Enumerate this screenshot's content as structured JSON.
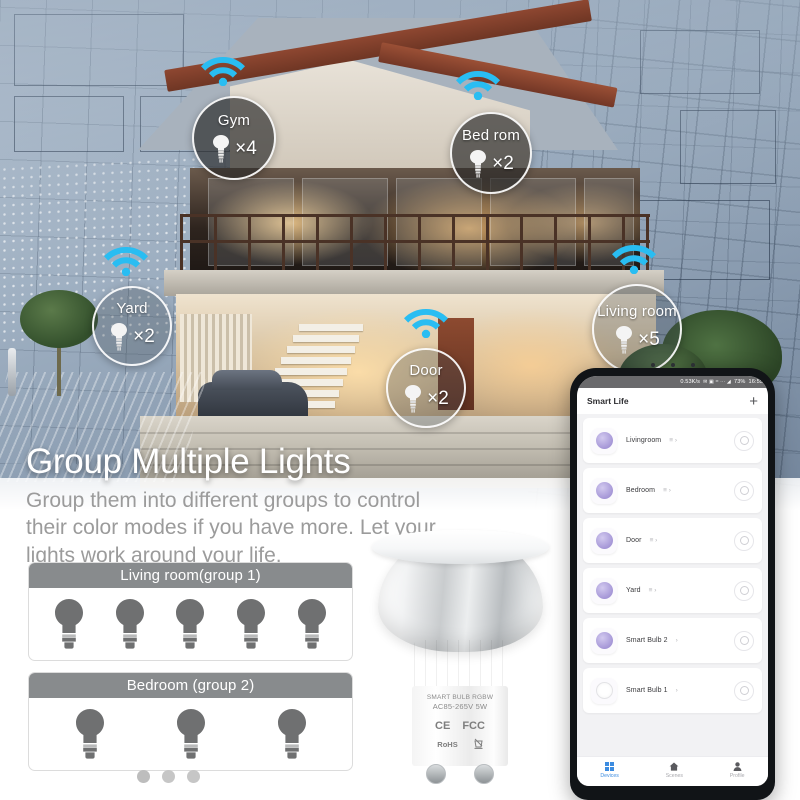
{
  "hero": {
    "headline": "Group Multiple Lights",
    "subcopy": "Group them into different groups to control their color modes if you have more. Let your lights work around your life."
  },
  "room_badges": [
    {
      "name": "Gym",
      "count": "×4",
      "icon": "spotlight-bulb-icon",
      "style": "solid"
    },
    {
      "name": "Bed rom",
      "count": "×2",
      "icon": "spotlight-bulb-icon",
      "style": "solid"
    },
    {
      "name": "Yard",
      "count": "×2",
      "icon": "spotlight-bulb-icon",
      "style": "ghost"
    },
    {
      "name": "Door",
      "count": "×2",
      "icon": "spotlight-bulb-icon",
      "style": "ghost"
    },
    {
      "name": "Living room",
      "count": "×5",
      "icon": "spotlight-bulb-icon",
      "style": "ghost"
    }
  ],
  "groups": [
    {
      "title": "Living room(group 1)",
      "bulbs": 5
    },
    {
      "title": "Bedroom (group 2)",
      "bulbs": 3
    }
  ],
  "carousel": {
    "dots": 3,
    "active": 0
  },
  "product": {
    "line1": "SMART BULB RGBW",
    "line2": "AC85-265V 5W",
    "mark_ce": "CE",
    "mark_fcc": "FCC",
    "mark_rohs": "RoHS",
    "mark_weee": "weee-bin-icon"
  },
  "phone": {
    "status": {
      "speed": "0.53K/s",
      "icons": "✉ ▣ ≈ ⋯ ◢",
      "battery": "73%",
      "time": "16:55"
    },
    "appbar": {
      "title": "Smart Life",
      "add": "+"
    },
    "devices": [
      {
        "name": "Livingroom",
        "meta": "≡ ›",
        "state": "on"
      },
      {
        "name": "Bedroom",
        "meta": "≡ ›",
        "state": "on"
      },
      {
        "name": "Door",
        "meta": "≡ ›",
        "state": "on"
      },
      {
        "name": "Yard",
        "meta": "≡ ›",
        "state": "on"
      },
      {
        "name": "Smart Bulb 2",
        "meta": "›",
        "state": "on"
      },
      {
        "name": "Smart Bulb 1",
        "meta": "›",
        "state": "off"
      }
    ],
    "tabs": [
      {
        "label": "Devices",
        "icon": "grid-icon",
        "active": true
      },
      {
        "label": "Scenes",
        "icon": "home-icon",
        "active": false
      },
      {
        "label": "Profile",
        "icon": "person-icon",
        "active": false
      }
    ]
  },
  "colors": {
    "wifi": "#29bdf2",
    "accent": "#3c8ce0",
    "bulb_purple": "#a495d6",
    "group_header": "#888b8d",
    "headline": "#ffffff",
    "subcopy": "#9b9b9b"
  }
}
